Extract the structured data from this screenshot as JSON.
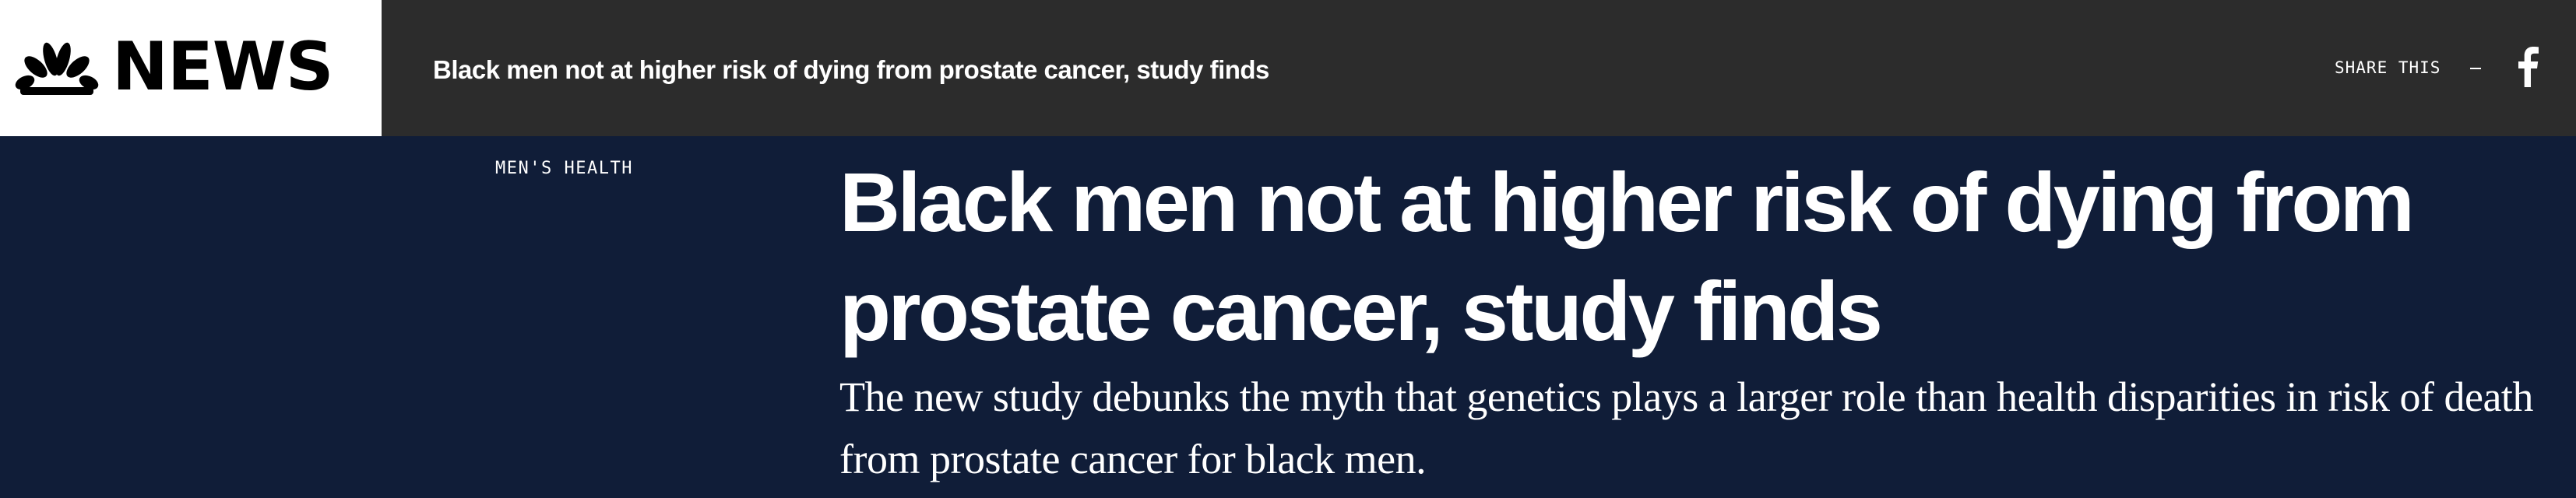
{
  "header": {
    "logo_text": "NEWS",
    "logo_icon": "nbc-peacock-icon",
    "sticky_headline": "Black men not at higher risk of dying from prostate cancer, study finds",
    "share_label": "SHARE THIS",
    "share_dash": "—",
    "facebook_icon": "facebook-icon"
  },
  "article": {
    "eyebrow": "MEN'S HEALTH",
    "headline": "Black men not at higher risk of dying from prostate cancer, study finds",
    "dek": "The new study debunks the myth that genetics plays a larger role than health disparities in risk of death from prostate cancer for black men."
  },
  "colors": {
    "topbar_bg": "#2c2c2c",
    "logo_bg": "#ffffff",
    "hero_bg": "#101d38",
    "text": "#ffffff"
  }
}
